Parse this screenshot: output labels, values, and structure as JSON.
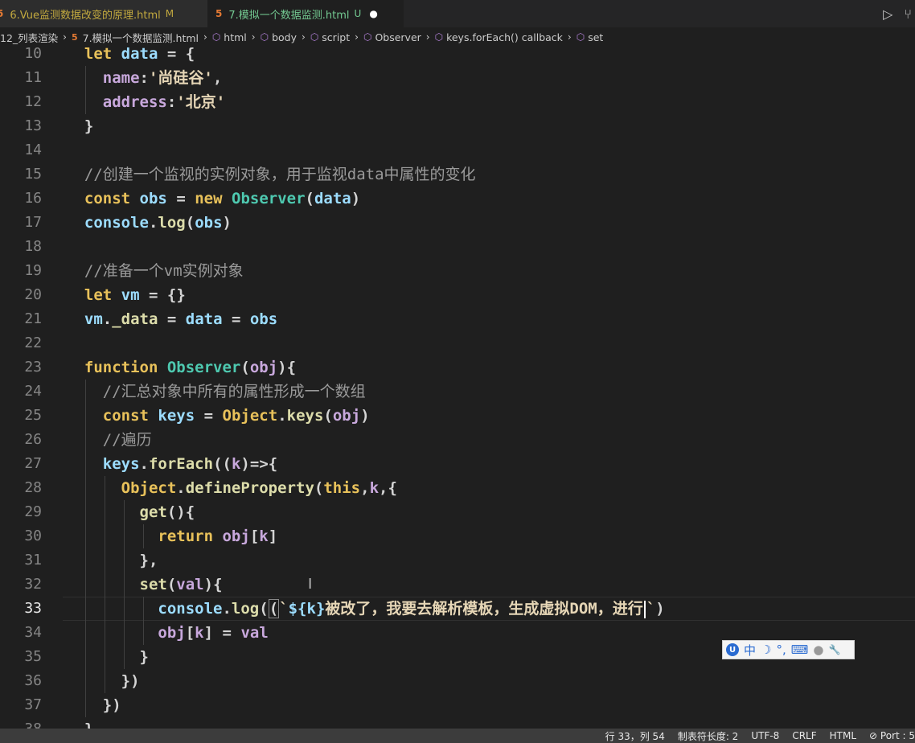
{
  "tabs": [
    {
      "label": "6.Vue监测数据改变的原理.html",
      "badge": "M",
      "active": false
    },
    {
      "label": "7.模拟一个数据监测.html",
      "badge": "U",
      "active": true,
      "unsaved_dot": "●"
    }
  ],
  "tab_icons": {
    "html": "5",
    "run": "▷",
    "split": "⑂"
  },
  "breadcrumb": [
    {
      "label": "12_列表渲染",
      "icon": ""
    },
    {
      "label": "7.模拟一个数据监测.html",
      "icon": "html5-icon"
    },
    {
      "label": "html",
      "icon": "symbol-icon"
    },
    {
      "label": "body",
      "icon": "symbol-icon"
    },
    {
      "label": "script",
      "icon": "symbol-icon"
    },
    {
      "label": "Observer",
      "icon": "symbol-icon"
    },
    {
      "label": "keys.forEach() callback",
      "icon": "symbol-icon"
    },
    {
      "label": "set",
      "icon": "symbol-icon"
    }
  ],
  "editor": {
    "current_line": 33,
    "lines": [
      {
        "n": "10",
        "text": "  let data = {"
      },
      {
        "n": "11",
        "text": "    name:'尚硅谷',"
      },
      {
        "n": "12",
        "text": "    address:'北京'"
      },
      {
        "n": "13",
        "text": "  }"
      },
      {
        "n": "14",
        "text": ""
      },
      {
        "n": "15",
        "text": "  //创建一个监视的实例对象，用于监视data中属性的变化"
      },
      {
        "n": "16",
        "text": "  const obs = new Observer(data)"
      },
      {
        "n": "17",
        "text": "  console.log(obs)"
      },
      {
        "n": "18",
        "text": ""
      },
      {
        "n": "19",
        "text": "  //准备一个vm实例对象"
      },
      {
        "n": "20",
        "text": "  let vm = {}"
      },
      {
        "n": "21",
        "text": "  vm._data = data = obs"
      },
      {
        "n": "22",
        "text": ""
      },
      {
        "n": "23",
        "text": "  function Observer(obj){"
      },
      {
        "n": "24",
        "text": "    //汇总对象中所有的属性形成一个数组"
      },
      {
        "n": "25",
        "text": "    const keys = Object.keys(obj)"
      },
      {
        "n": "26",
        "text": "    //遍历"
      },
      {
        "n": "27",
        "text": "    keys.forEach((k)=>{"
      },
      {
        "n": "28",
        "text": "      Object.defineProperty(this,k,{"
      },
      {
        "n": "29",
        "text": "        get(){"
      },
      {
        "n": "30",
        "text": "          return obj[k]"
      },
      {
        "n": "31",
        "text": "        },"
      },
      {
        "n": "32",
        "text": "        set(val){"
      },
      {
        "n": "33",
        "text": "          console.log(`${k}被改了，我要去解析模板，生成虚拟DOM，进行`)"
      },
      {
        "n": "34",
        "text": "          obj[k] = val"
      },
      {
        "n": "35",
        "text": "        }"
      },
      {
        "n": "36",
        "text": "      })"
      },
      {
        "n": "37",
        "text": "    })"
      },
      {
        "n": "38",
        "text": "  }"
      }
    ]
  },
  "ime_toolbar": {
    "mode": "中",
    "items": [
      "☽",
      "°,",
      "⌨",
      "●",
      "🔧"
    ]
  },
  "statusbar": {
    "position": "行 33，列 54",
    "tab_size": "制表符长度: 2",
    "encoding": "UTF-8",
    "eol": "CRLF",
    "language": "HTML",
    "port": "⊘ Port : 5"
  },
  "colors": {
    "background": "#1f1f1f",
    "keyword": "#e8c15a",
    "variable": "#9cdcfe",
    "property": "#c8a8dc",
    "class": "#4ec9b0",
    "comment": "#9a9a9a",
    "modified_tab": "#c2a93f",
    "untracked_tab": "#73c991"
  }
}
